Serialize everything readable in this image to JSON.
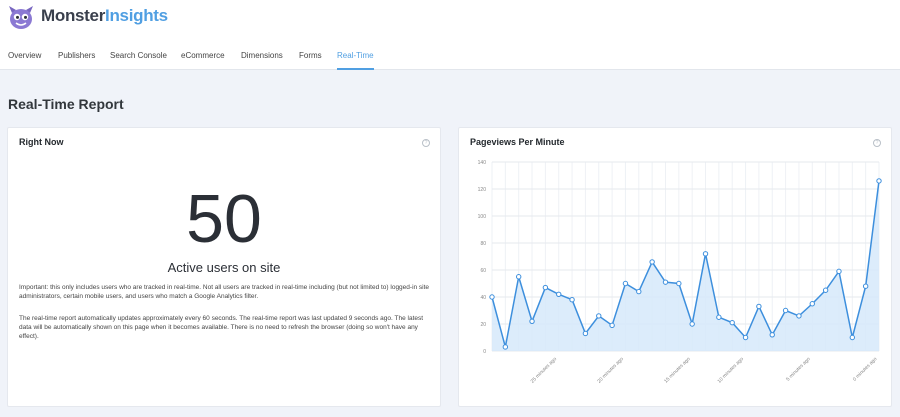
{
  "app": {
    "brand_part1": "Monster",
    "brand_part2": "Insights"
  },
  "colors": {
    "accent": "#509fe2",
    "line": "#3d8fdd",
    "area": "#d6e9fa"
  },
  "nav": {
    "tabs": [
      "Overview",
      "Publishers",
      "Search Console",
      "eCommerce",
      "Dimensions",
      "Forms",
      "Real-Time"
    ],
    "active_tab": "Real-Time"
  },
  "page": {
    "title": "Real-Time Report"
  },
  "right_now": {
    "title": "Right Now",
    "count": "50",
    "count_label": "Active users on site",
    "note1": "Important: this only includes users who are tracked in real-time. Not all users are tracked in real-time including (but not limited to) logged-in site administrators, certain mobile users, and users who match a Google Analytics filter.",
    "note2": "The real-time report automatically updates approximately every 60 seconds. The real-time report was last updated 9 seconds ago. The latest data will be automatically shown on this page when it becomes available. There is no need to refresh the browser (doing so won't have any effect).",
    "info_icon": "info-icon"
  },
  "pageviews": {
    "title": "Pageviews Per Minute",
    "info_icon": "info-icon"
  },
  "chart_data": {
    "type": "area",
    "title": "Pageviews Per Minute",
    "ylim": [
      0,
      140
    ],
    "yticks": [
      "0",
      "20",
      "40",
      "60",
      "80",
      "100",
      "120",
      "140"
    ],
    "grid": true,
    "x_tick_labels": [
      "25 minutes ago",
      "20 minutes ago",
      "15 minutes ago",
      "10 minutes ago",
      "5 minutes ago",
      "0 minutes ago"
    ],
    "series": [
      {
        "values": [
          40,
          3,
          55,
          22,
          47,
          42,
          38,
          13,
          26,
          19,
          50,
          44,
          66,
          51,
          50,
          20,
          72,
          25,
          21,
          10,
          33,
          12,
          30,
          26,
          35,
          45,
          59,
          10,
          48,
          126
        ]
      }
    ]
  }
}
